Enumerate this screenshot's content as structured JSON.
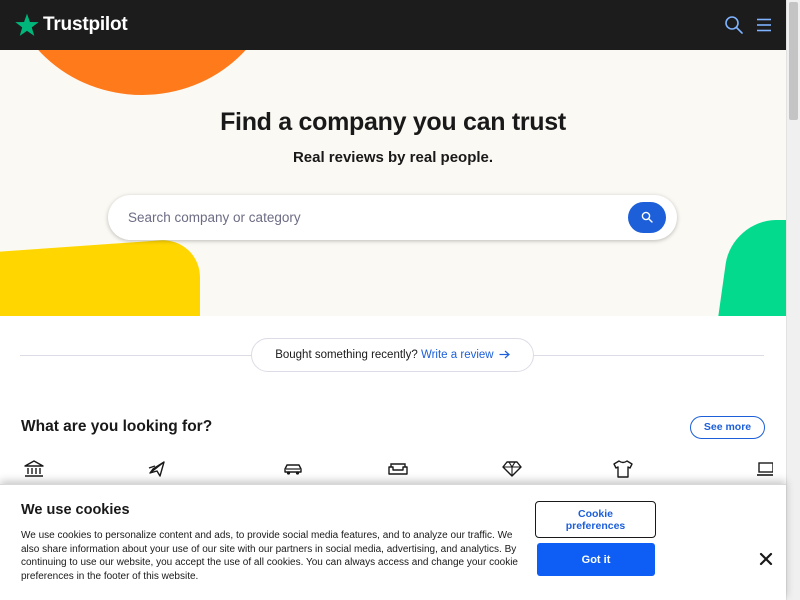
{
  "header": {
    "brand": "Trustpilot",
    "icons": [
      "search-icon",
      "menu-icon"
    ]
  },
  "hero": {
    "title": "Find a company you can trust",
    "subtitle": "Real reviews by real people.",
    "search_placeholder": "Search company or category",
    "search_value": "",
    "search_button_icon": "search-icon"
  },
  "bought": {
    "text": "Bought something recently?",
    "link_label": "Write a review",
    "link_icon": "arrow-right-icon"
  },
  "categories": {
    "title": "What are you looking for?",
    "see_more_label": "See more",
    "icons": [
      "bank-icon",
      "airplane-icon",
      "car-icon",
      "sofa-icon",
      "diamond-icon",
      "tshirt-icon",
      "laptop-icon"
    ]
  },
  "cookie": {
    "title": "We use cookies",
    "body": "We use cookies to personalize content and ads, to provide social media features, and to analyze our traffic. We also share information about your use of our site with our partners in social media, advertising, and analytics. By continuing to use our website, you accept the use of all cookies. You can always access and change your cookie preferences in the footer of this website.",
    "preferences_label": "Cookie preferences",
    "accept_label": "Got it",
    "close_icon": "close-icon"
  },
  "colors": {
    "header_bg": "#1c1c1c",
    "brand_star": "#00b67a",
    "accent_blue": "#1c5fd9",
    "hero_bg": "#fbf9f3",
    "blob_orange": "#ff7a1a",
    "blob_yellow": "#ffd600",
    "blob_green": "#04da8d"
  }
}
